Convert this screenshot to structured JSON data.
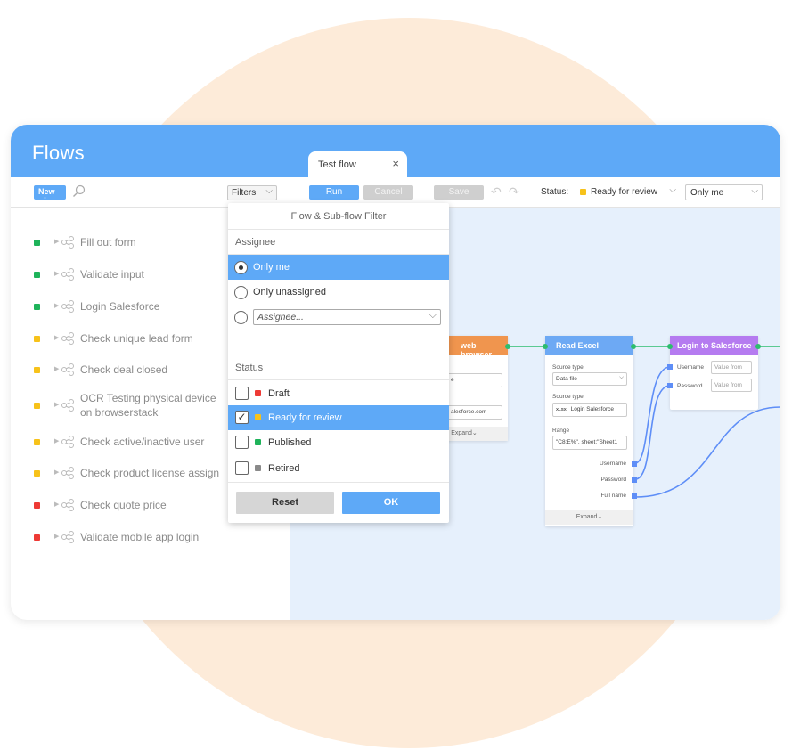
{
  "header": {
    "title": "Flows"
  },
  "tab": {
    "label": "Test flow",
    "close": "×"
  },
  "left_toolbar": {
    "new_label": "New",
    "new_more": "⋮",
    "filters_label": "Filters",
    "chevron": "⌵"
  },
  "right_toolbar": {
    "run_label": "Run",
    "cancel_label": "Cancel",
    "save_label": "Save",
    "undo": "↶",
    "redo": "↷",
    "status_label": "Status:",
    "status_value": "Ready for review",
    "assignee_value": "Only me"
  },
  "flows": [
    {
      "name": "Fill out form",
      "status": "green"
    },
    {
      "name": "Validate input",
      "status": "green"
    },
    {
      "name": "Login Salesforce",
      "status": "green"
    },
    {
      "name": "Check unique lead form",
      "status": "yellow"
    },
    {
      "name": "Check deal closed",
      "status": "yellow"
    },
    {
      "name": "OCR Testing physical device",
      "name2": "on browserstack",
      "status": "yellow"
    },
    {
      "name": "Check active/inactive user",
      "status": "yellow"
    },
    {
      "name": "Check product license assign",
      "status": "yellow"
    },
    {
      "name": "Check quote price",
      "status": "red"
    },
    {
      "name": "Validate mobile app login",
      "status": "red"
    }
  ],
  "status_colors": {
    "green": "#1fb35a",
    "yellow": "#f7c21a",
    "red": "#ee3a35",
    "gray": "#8a8a8a"
  },
  "popup": {
    "title": "Flow & Sub-flow Filter",
    "assignee_heading": "Assignee",
    "assignee_options": [
      "Only me",
      "Only unassigned"
    ],
    "assignee_placeholder": "Assignee...",
    "status_heading": "Status",
    "status_options": [
      {
        "label": "Draft",
        "color": "red",
        "checked": false
      },
      {
        "label": "Ready for review",
        "color": "yellow",
        "checked": true
      },
      {
        "label": "Published",
        "color": "green",
        "checked": false
      },
      {
        "label": "Retired",
        "color": "gray",
        "checked": false
      }
    ],
    "check_mark": "✓",
    "reset_label": "Reset",
    "ok_label": "OK"
  },
  "nodes": {
    "browser": {
      "title": "web browser",
      "field_value_1": "e",
      "field_value_2": "alesforce.com",
      "expand": "Expand⌄"
    },
    "excel": {
      "title": "Read Excel",
      "source_type_label": "Source type",
      "source_type_value": "Data file",
      "source_type_label2": "Source type",
      "file_value": "Login Salesforce",
      "file_badge": "XLSX",
      "range_label": "Range",
      "range_value": "\"C8:E%\", sheet:\"Sheet1",
      "outputs": [
        "Username",
        "Password",
        "Full name"
      ],
      "expand": "Expand⌄"
    },
    "login": {
      "title": "Login to Salesforce",
      "inputs": [
        "Username",
        "Password"
      ],
      "value_placeholder": "Value from"
    }
  }
}
